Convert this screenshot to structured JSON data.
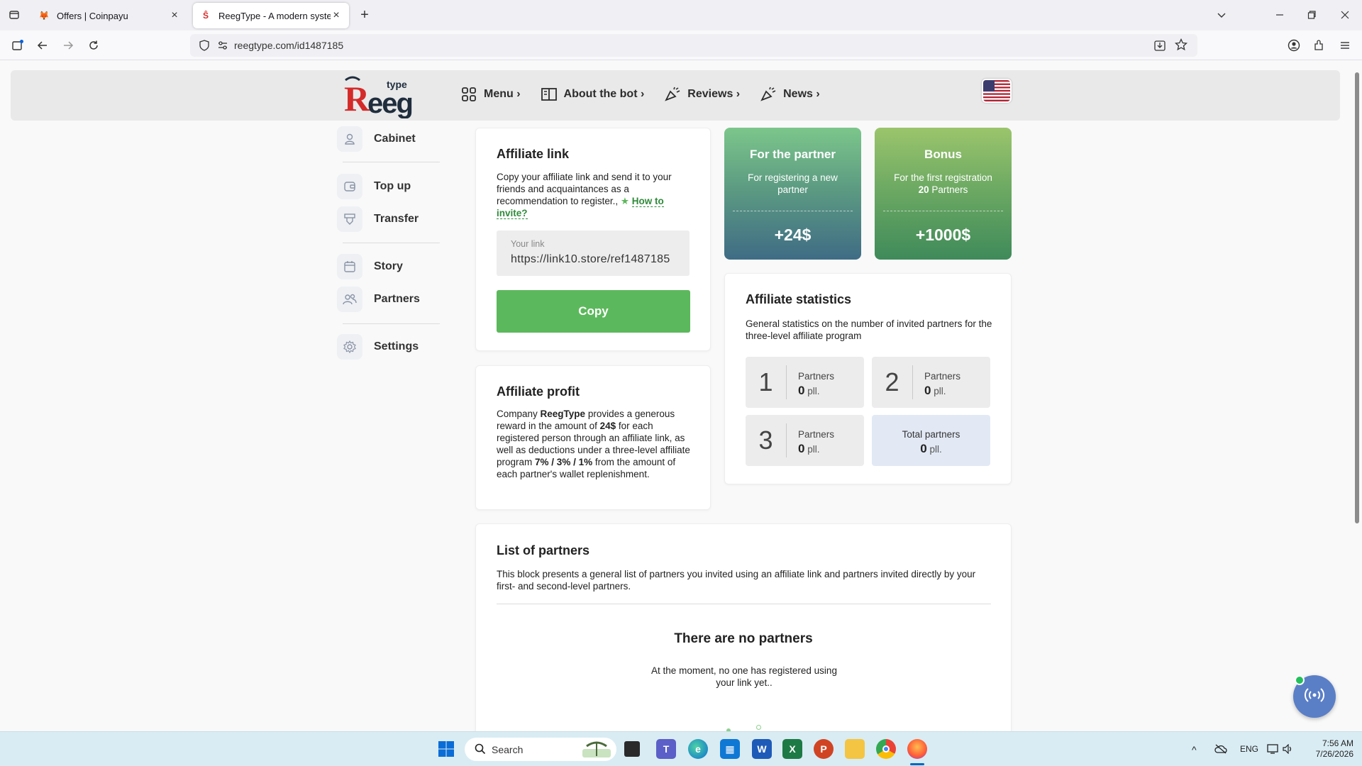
{
  "browser": {
    "tabs": [
      {
        "title": "Offers | Coinpayu",
        "active": false
      },
      {
        "title": "ReegType - A modern system fo",
        "active": true
      }
    ],
    "url": "reegtype.com/id1487185"
  },
  "header": {
    "logo_main": "Reeg",
    "logo_sup": "type",
    "menu": [
      {
        "label": "Menu ›",
        "icon": "grid-icon"
      },
      {
        "label": "About the bot ›",
        "icon": "book-icon"
      },
      {
        "label": "Reviews ›",
        "icon": "megaphone-icon"
      },
      {
        "label": "News ›",
        "icon": "megaphone-icon"
      }
    ],
    "flag": "us-flag"
  },
  "sidebar": {
    "items": [
      {
        "label": "Cabinet",
        "icon": "user-icon"
      },
      {
        "label": "Top up",
        "icon": "wallet-icon"
      },
      {
        "label": "Transfer",
        "icon": "transfer-icon"
      },
      {
        "label": "Story",
        "icon": "calendar-icon"
      },
      {
        "label": "Partners",
        "icon": "users-icon"
      },
      {
        "label": "Settings",
        "icon": "gear-icon"
      }
    ]
  },
  "affiliate_link": {
    "title": "Affiliate link",
    "desc": "Copy your affiliate link and send it to your friends and acquaintances as a recommendation to register.,",
    "how_to": "How to invite?",
    "link_label": "Your link",
    "link_value": "https://link10.store/ref1487185",
    "copy_label": "Copy"
  },
  "affiliate_profit": {
    "title": "Affiliate profit",
    "text_1": "Company",
    "brand": "ReegType",
    "text_2": "provides a generous reward in the amount of",
    "amount": "24$",
    "text_3": "for each registered person through an affiliate link, as well as deductions under a three-level affiliate program",
    "levels": "7% / 3% / 1%",
    "text_4": "from the amount of each partner's wallet replenishment."
  },
  "promo_partner": {
    "title": "For the partner",
    "sub": "For registering a new partner",
    "amount": "+24$"
  },
  "promo_bonus": {
    "title": "Bonus",
    "sub_1": "For the first registration",
    "sub_count": "20",
    "sub_2": "Partners",
    "amount": "+1000$"
  },
  "stats": {
    "title": "Affiliate statistics",
    "desc": "General statistics on the number of invited partners for the three-level affiliate program",
    "levels": [
      {
        "num": "1",
        "label": "Partners",
        "count": "0",
        "unit": "pll."
      },
      {
        "num": "2",
        "label": "Partners",
        "count": "0",
        "unit": "pll."
      },
      {
        "num": "3",
        "label": "Partners",
        "count": "0",
        "unit": "pll."
      }
    ],
    "total_label": "Total partners",
    "total_count": "0",
    "total_unit": "pll."
  },
  "partners_list": {
    "title": "List of partners",
    "desc": "This block presents a general list of partners you invited using an affiliate link and partners invited directly by your first- and second-level partners.",
    "empty_title": "There are no partners",
    "empty_text": "At the moment, no one has registered using your link yet.."
  },
  "taskbar": {
    "search": "Search",
    "lang": "ENG",
    "time": "7:56 AM",
    "date": "7/26/2026"
  },
  "colors": {
    "green_button": "#5cb85c",
    "promo_partner_top": "#7cc68b",
    "promo_partner_bottom": "#3f6c85",
    "promo_bonus_top": "#9bc56c",
    "promo_bonus_bottom": "#3f8a5a",
    "total_box": "#e2e9f5",
    "link_green": "#2e8b3a",
    "logo_red": "#d42a2a",
    "logo_dark": "#1f2d3d"
  }
}
